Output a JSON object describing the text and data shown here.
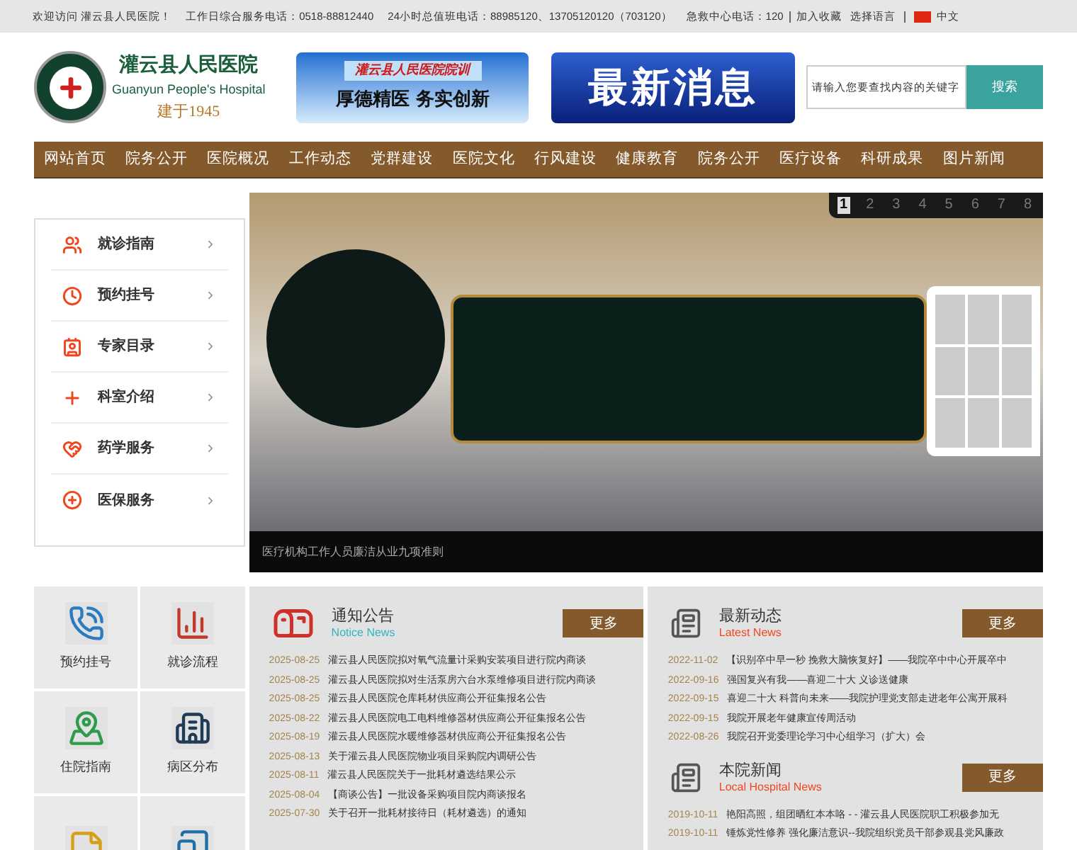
{
  "top_bar": {
    "items": [
      "欢迎访问 灌云县人民医院！",
      "工作日综合服务电话：0518-88812440",
      "24小时总值班电话：88985120、13705120120（703120）",
      "急救中心电话：120"
    ],
    "bookmark": "加入收藏",
    "language_label": "选择语言",
    "language": "中文"
  },
  "header": {
    "logo": {
      "name": "灌云县人民医院",
      "english": "Guanyun People's Hospital",
      "founded": "建于1945"
    },
    "motto": {
      "title": "灌云县人民医院院训",
      "text": "厚德精医 务实创新"
    },
    "news_banner": "最新消息",
    "search": {
      "placeholder": "请输入您要查找内容的关键字",
      "button": "搜索"
    }
  },
  "nav": [
    "网站首页",
    "院务公开",
    "医院概况",
    "工作动态",
    "党群建设",
    "医院文化",
    "行风建设",
    "健康教育",
    "院务公开",
    "医疗设备",
    "科研成果",
    "图片新闻"
  ],
  "sidebar": [
    {
      "kind": "guide",
      "label": "就诊指南"
    },
    {
      "kind": "clock",
      "label": "预约挂号"
    },
    {
      "kind": "experts",
      "label": "专家目录"
    },
    {
      "kind": "cross",
      "label": "科室介绍"
    },
    {
      "kind": "heart",
      "label": "药学服务"
    },
    {
      "kind": "plus",
      "label": "医保服务"
    }
  ],
  "slider": {
    "pages": [
      {
        "label": "1",
        "selected": true
      },
      {
        "label": "2",
        "selected": false
      },
      {
        "label": "3",
        "selected": false
      },
      {
        "label": "4",
        "selected": false
      },
      {
        "label": "5",
        "selected": false
      },
      {
        "label": "6",
        "selected": false
      },
      {
        "label": "7",
        "selected": false
      },
      {
        "label": "8",
        "selected": false
      }
    ],
    "caption": "医疗机构工作人员廉洁从业九项准则"
  },
  "quick_links": [
    {
      "kind": "phone",
      "label": "预约挂号"
    },
    {
      "kind": "chart",
      "label": "就诊流程"
    },
    {
      "kind": "map",
      "label": "住院指南"
    },
    {
      "kind": "building",
      "label": "病区分布"
    },
    {
      "kind": "note"
    },
    {
      "kind": "tablet"
    }
  ],
  "notice": {
    "title": "通知公告",
    "subtitle": "Notice News",
    "more": "更多",
    "items": [
      {
        "date": "2025-08-25",
        "title": "灌云县人民医院拟对氧气流量计采购安装项目进行院内商谈"
      },
      {
        "date": "2025-08-25",
        "title": "灌云县人民医院拟对生活泵房六台水泵维修项目进行院内商谈"
      },
      {
        "date": "2025-08-25",
        "title": "灌云县人民医院仓库耗材供应商公开征集报名公告"
      },
      {
        "date": "2025-08-22",
        "title": "灌云县人民医院电工电料维修器材供应商公开征集报名公告"
      },
      {
        "date": "2025-08-19",
        "title": "灌云县人民医院水暖维修器材供应商公开征集报名公告"
      },
      {
        "date": "2025-08-13",
        "title": "关于灌云县人民医院物业项目采购院内调研公告"
      },
      {
        "date": "2025-08-11",
        "title": "灌云县人民医院关于一批耗材遴选结果公示"
      },
      {
        "date": "2025-08-04",
        "title": "【商谈公告】一批设备采购项目院内商谈报名"
      },
      {
        "date": "2025-07-30",
        "title": "关于召开一批耗材接待日（耗材遴选）的通知"
      }
    ]
  },
  "latest_news": {
    "title": "最新动态",
    "subtitle": "Latest News",
    "more": "更多",
    "items": [
      {
        "date": "2022-11-02",
        "title": "【识别卒中早一秒 挽救大脑恢复好】——我院卒中中心开展卒中"
      },
      {
        "date": "2022-09-16",
        "title": "强国复兴有我——喜迎二十大 义诊送健康"
      },
      {
        "date": "2022-09-15",
        "title": "喜迎二十大 科普向未来——我院护理党支部走进老年公寓开展科"
      },
      {
        "date": "2022-09-15",
        "title": "我院开展老年健康宣传周活动"
      },
      {
        "date": "2022-08-26",
        "title": "我院召开党委理论学习中心组学习（扩大）会"
      }
    ]
  },
  "local_news": {
    "title": "本院新闻",
    "subtitle": "Local Hospital News",
    "more": "更多",
    "items": [
      {
        "date": "2019-10-11",
        "title": "艳阳高照，组团晒红本本咯 - - 灌云县人民医院职工积极参加无"
      },
      {
        "date": "2019-10-11",
        "title": "锤炼党性修养 强化廉洁意识--我院组织党员干部参观县党风廉政"
      }
    ]
  }
}
